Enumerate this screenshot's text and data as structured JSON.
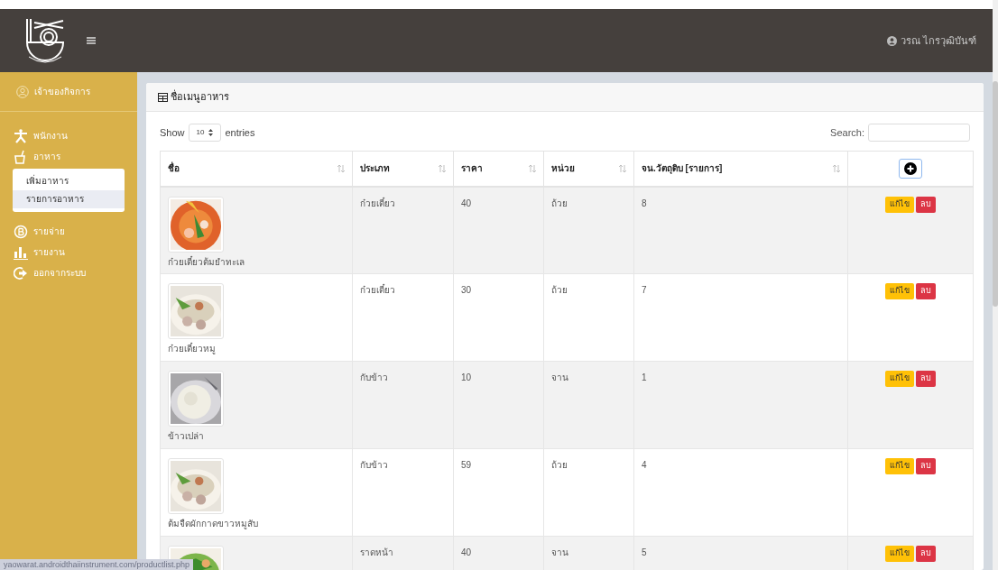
{
  "header": {
    "user": "วรณ ไกรวุฒิบันฑ์"
  },
  "sidebar": {
    "owner": "เจ้าของกิจการ",
    "items": [
      {
        "label": "พนักงาน"
      },
      {
        "label": "อาหาร",
        "expanded": true,
        "children": [
          {
            "label": "เพิ่มอาหาร",
            "selected": false
          },
          {
            "label": "รายการอาหาร",
            "selected": true
          }
        ]
      },
      {
        "label": "รายจ่าย"
      },
      {
        "label": "รายงาน"
      },
      {
        "label": "ออกจากระบบ"
      }
    ]
  },
  "card": {
    "title": "ชื่อเมนูอาหาร",
    "length": {
      "before": "Show",
      "value": "10",
      "after": "entries"
    },
    "search": {
      "label": "Search:"
    },
    "table": {
      "columns": [
        "ชื่อ",
        "ประเภท",
        "ราคา",
        "หน่วย",
        "จน.วัตถุดิบ [รายการ]"
      ],
      "rows": [
        {
          "name": "ก๋วยเตี๋ยวต้มยำทะเล",
          "type": "ก๋วยเตี๋ยว",
          "price": "40",
          "unit": "ถ้วย",
          "count": "8",
          "kind": "soup-red",
          "edit": "แก้ไข",
          "delete": "ลบ"
        },
        {
          "name": "ก๋วยเตี๋ยวหมู",
          "type": "ก๋วยเตี๋ยว",
          "price": "30",
          "unit": "ถ้วย",
          "count": "7",
          "kind": "soup-clear",
          "edit": "แก้ไข",
          "delete": "ลบ"
        },
        {
          "name": "ข้าวเปล่า",
          "type": "กับข้าว",
          "price": "10",
          "unit": "จาน",
          "count": "1",
          "kind": "rice",
          "edit": "แก้ไข",
          "delete": "ลบ"
        },
        {
          "name": "ต้มจืดผักกาดขาวหมูสับ",
          "type": "กับข้าว",
          "price": "59",
          "unit": "ถ้วย",
          "count": "4",
          "kind": "soup-clear",
          "edit": "แก้ไข",
          "delete": "ลบ"
        },
        {
          "type": "ราดหน้า",
          "price": "40",
          "unit": "จาน",
          "count": "5",
          "kind": "greens",
          "edit": "แก้ไข",
          "delete": "ลบ"
        }
      ]
    }
  },
  "status_url": "yaowarat.androidthaiinstrument.com/productlist.php"
}
